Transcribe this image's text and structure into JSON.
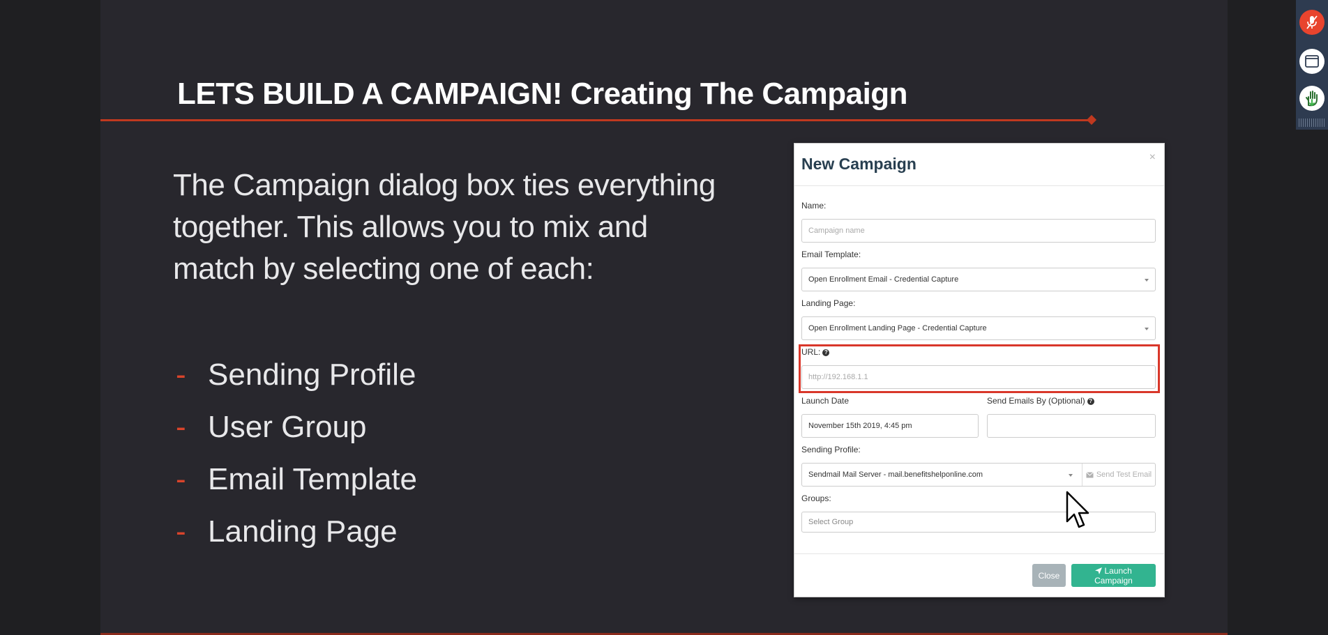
{
  "slide": {
    "title": "LETS BUILD A CAMPAIGN! Creating The Campaign",
    "intro": "The Campaign dialog box ties everything together. This allows you to mix and match by selecting one of each:",
    "bullet_marker": "-",
    "bullets": [
      "Sending Profile",
      "User Group",
      "Email Template",
      "Landing Page"
    ]
  },
  "dialog": {
    "title": "New Campaign",
    "close_symbol": "×",
    "name": {
      "label": "Name:",
      "placeholder": "Campaign name"
    },
    "email_template": {
      "label": "Email Template:",
      "value": "Open Enrollment Email - Credential Capture"
    },
    "landing_page": {
      "label": "Landing Page:",
      "value": "Open Enrollment Landing Page - Credential Capture"
    },
    "url": {
      "label": "URL:",
      "help": "?",
      "placeholder": "http://192.168.1.1"
    },
    "launch_date": {
      "label": "Launch Date",
      "value": "November 15th 2019, 4:45 pm"
    },
    "send_by": {
      "label": "Send Emails By (Optional)",
      "help": "?",
      "value": ""
    },
    "sending_profile": {
      "label": "Sending Profile:",
      "value": "Sendmail Mail Server - mail.benefitshelponline.com",
      "test_button": "Send Test Email"
    },
    "groups": {
      "label": "Groups:",
      "placeholder": "Select Group"
    },
    "buttons": {
      "close": "Close",
      "launch": "Launch Campaign"
    }
  },
  "colors": {
    "accent": "#c0391f",
    "launch_button": "#32b490",
    "close_button": "#a8b3b8",
    "highlight_box": "#d9372a",
    "mic_muted": "#e8442e"
  },
  "toolbar": {
    "icons": [
      "mic-muted-icon",
      "window-icon",
      "raise-hand-icon"
    ]
  }
}
